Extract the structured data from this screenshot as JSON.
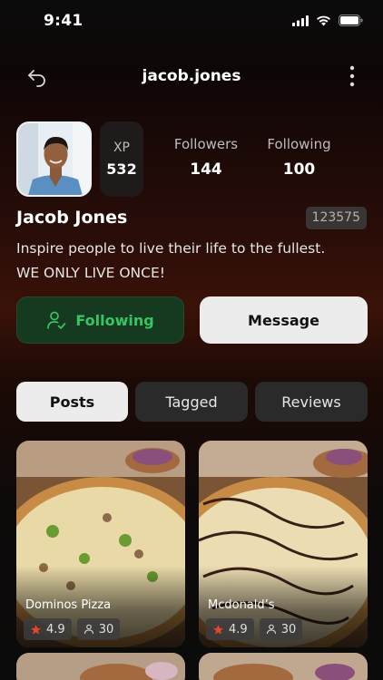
{
  "status": {
    "time": "9:41"
  },
  "header": {
    "title": "jacob.jones"
  },
  "profile": {
    "xp_label": "XP",
    "xp_value": "532",
    "followers_label": "Followers",
    "followers_value": "144",
    "following_label": "Following",
    "following_value": "100",
    "name": "Jacob Jones",
    "user_id": "123575",
    "bio_line1": "Inspire people to live their life to the fullest.",
    "bio_line2": "WE ONLY LIVE ONCE!"
  },
  "actions": {
    "following_label": "Following",
    "message_label": "Message"
  },
  "tabs": [
    {
      "label": "Posts",
      "active": true
    },
    {
      "label": "Tagged",
      "active": false
    },
    {
      "label": "Reviews",
      "active": false
    }
  ],
  "posts": [
    {
      "name": "Dominos Pizza",
      "rating": "4.9",
      "people": "30"
    },
    {
      "name": "Mcdonald’s",
      "rating": "4.9",
      "people": "30"
    }
  ],
  "colors": {
    "accent_green": "#37c464",
    "star": "#e8452c"
  }
}
